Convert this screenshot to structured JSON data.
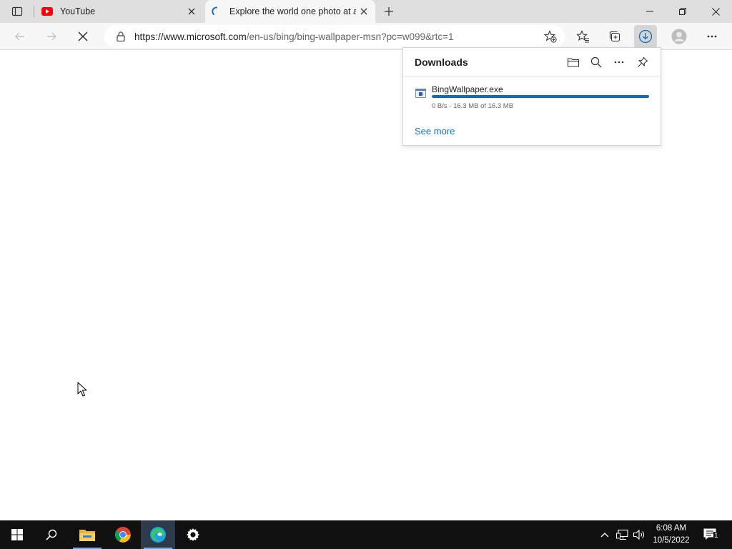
{
  "browser": {
    "tabs": [
      {
        "title": "YouTube",
        "favicon": "youtube-icon",
        "active": false
      },
      {
        "title": "Explore the world one photo at a time",
        "favicon": "loading-spinner-icon",
        "active": true
      }
    ],
    "new_tab_icon": "plus-icon",
    "window_controls": [
      "minimize-icon",
      "restore-icon",
      "close-icon"
    ]
  },
  "toolbar": {
    "back_icon": "back-arrow-icon",
    "forward_icon": "forward-arrow-icon",
    "stop_icon": "stop-loading-icon",
    "address": {
      "host": "https://www.microsoft.com",
      "path": "/en-us/bing/bing-wallpaper-msn?pc=w099&rtc=1"
    },
    "buttons": [
      "add-favorite-icon",
      "favorites-icon",
      "collections-icon",
      "downloads-icon",
      "profile-icon",
      "more-icon"
    ]
  },
  "downloads": {
    "title": "Downloads",
    "header_icons": [
      "folder-icon",
      "search-icon",
      "more-icon",
      "pin-icon"
    ],
    "items": [
      {
        "name": "BingWallpaper.exe",
        "status": "0 B/s - 16.3 MB of 16.3 MB",
        "progress": 1.0
      }
    ],
    "see_more": "See more"
  },
  "taskbar": {
    "apps": [
      "start-icon",
      "search-icon",
      "file-explorer-icon",
      "chrome-icon",
      "edge-icon",
      "settings-icon"
    ],
    "tray": [
      "chevron-up-icon",
      "network-icon",
      "volume-icon"
    ],
    "time": "6:08 AM",
    "date": "10/5/2022",
    "notification_count": "1"
  },
  "colors": {
    "accent": "#0f6cbd",
    "link": "#1a73b8",
    "taskbar": "#101010",
    "tabstrip": "#dfdfdf"
  }
}
